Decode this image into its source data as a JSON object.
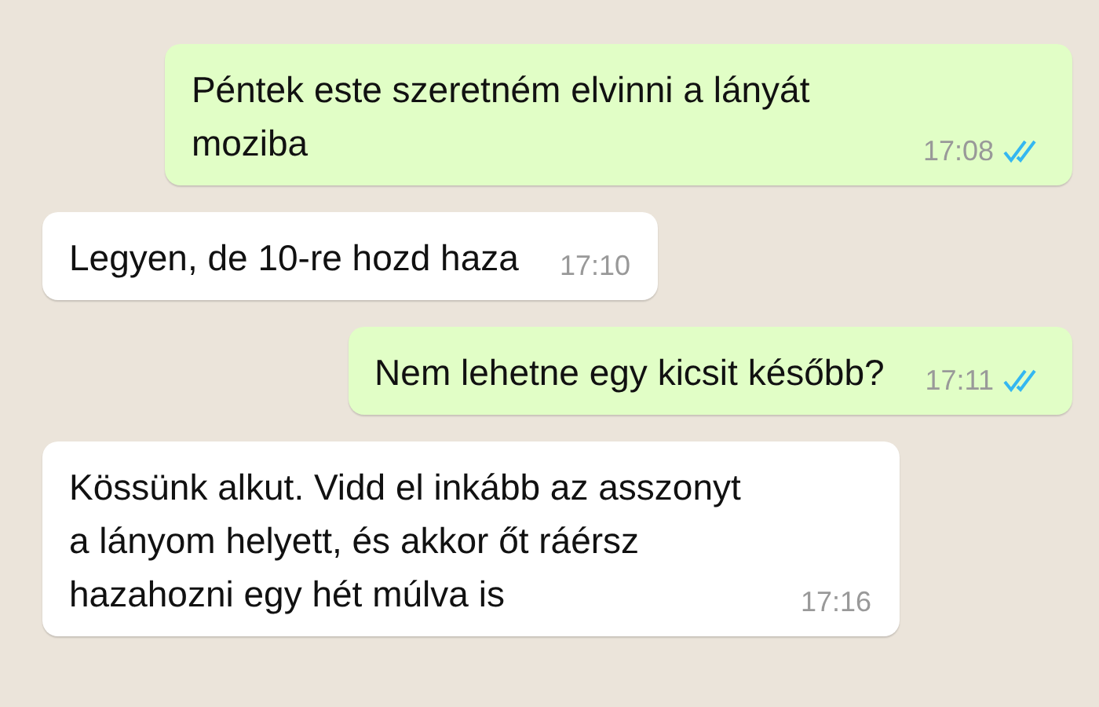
{
  "messages": [
    {
      "outgoing": true,
      "text": "Péntek este szeretném elvinni a lányát moziba",
      "time": "17:08",
      "read": true
    },
    {
      "outgoing": false,
      "text": "Legyen, de 10-re hozd haza",
      "time": "17:10"
    },
    {
      "outgoing": true,
      "text": "Nem lehetne egy kicsit később?",
      "time": "17:11",
      "read": true
    },
    {
      "outgoing": false,
      "text": "Kössünk alkut. Vidd el inkább az asszonyt a lányom helyett, és akkor őt ráérsz hazahozni egy hét múlva is",
      "time": "17:16"
    }
  ]
}
